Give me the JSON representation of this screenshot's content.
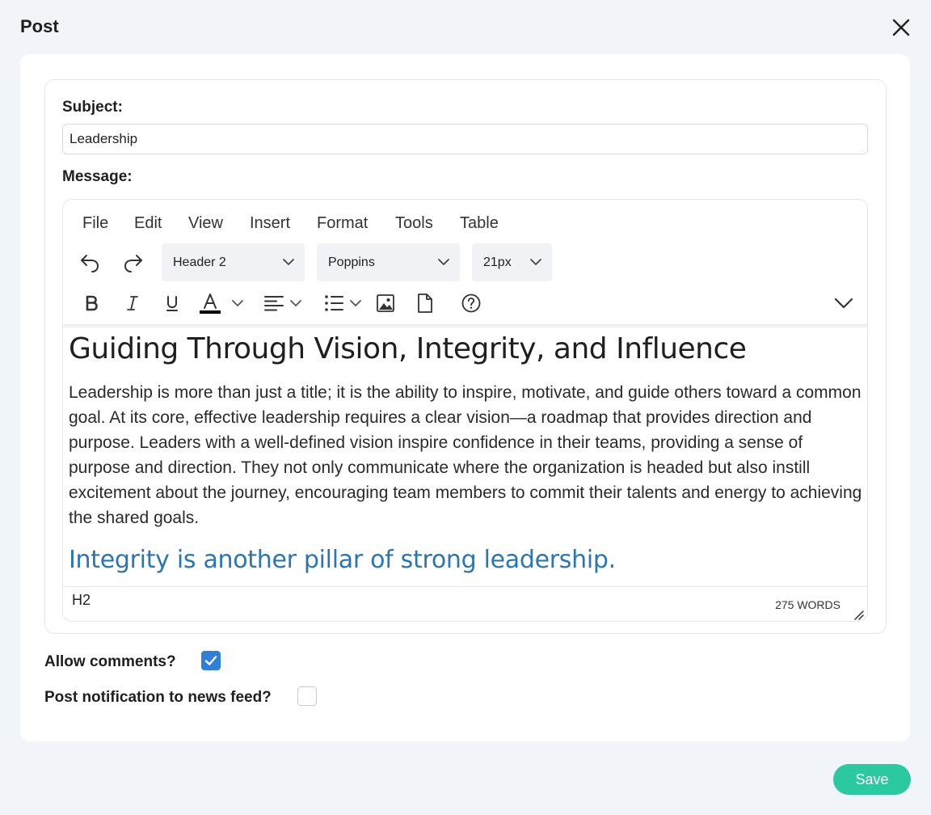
{
  "dialog": {
    "title": "Post"
  },
  "form": {
    "subject_label": "Subject:",
    "subject_value": "Leadership",
    "message_label": "Message:"
  },
  "editor": {
    "menu": [
      "File",
      "Edit",
      "View",
      "Insert",
      "Format",
      "Tools",
      "Table"
    ],
    "block_format": "Header 2",
    "font_family": "Poppins",
    "font_size": "21px",
    "text_color": "#000000",
    "toolbar_icons": [
      "undo-icon",
      "redo-icon",
      "bold-icon",
      "italic-icon",
      "underline-icon",
      "text-color-icon",
      "align-left-icon",
      "bullet-list-icon",
      "image-icon",
      "document-icon",
      "help-icon",
      "more-chevron-icon"
    ],
    "content": {
      "heading": "Guiding Through Vision, Integrity, and Influence",
      "paragraph": "Leadership is more than just a title; it is the ability to inspire, motivate, and guide others toward a common goal. At its core, effective leadership requires a clear vision—a roadmap that provides direction and purpose. Leaders with a well-defined vision inspire confidence in their teams, providing a sense of purpose and direction. They not only communicate where the organization is headed but also instill excitement about the journey, encouraging team members to commit their talents and energy to achieving the shared goals.",
      "subheading": "Integrity is another pillar of strong leadership.",
      "subheading_color": "#2a75b3"
    },
    "status": {
      "path": "H2",
      "word_count": "275 WORDS"
    }
  },
  "options": {
    "allow_comments_label": "Allow comments?",
    "allow_comments": true,
    "news_feed_label": "Post notification to news feed?",
    "news_feed": false
  },
  "actions": {
    "save_label": "Save",
    "save_color": "#2bc99f"
  }
}
